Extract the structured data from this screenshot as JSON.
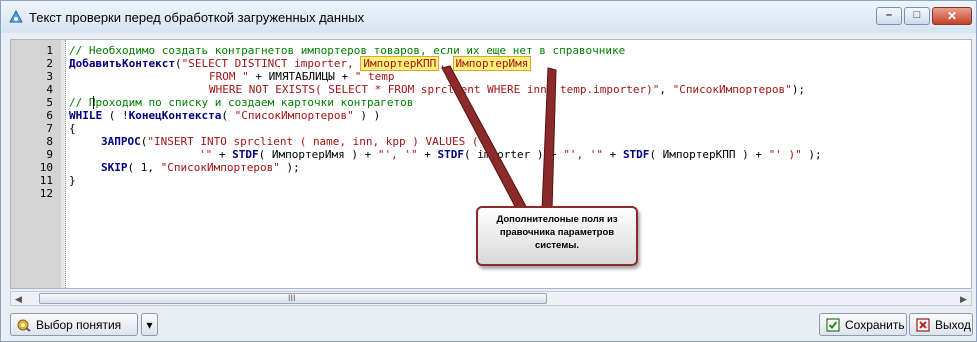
{
  "window": {
    "title": "Текст проверки перед обработкой загруженных данных",
    "controls": {
      "minimize": "–",
      "maximize": "□",
      "close": "✕"
    }
  },
  "editor": {
    "line_numbers": [
      "1",
      "2",
      "3",
      "4",
      "5",
      "6",
      "7",
      "8",
      "9",
      "10",
      "11",
      "12"
    ],
    "lines": {
      "l1": "// Необходимо создать контрагнетов импортеров товаров, если их еще нет в справочнике",
      "l2_fn": "ДобавитьКонтекст",
      "l2_open": "(",
      "l2_str": "\"SELECT DISTINCT importer, ",
      "l2_hl1": "ИмпортерКПП",
      "l2_sep": ", ",
      "l2_hl2": "ИмпортерИмя",
      "l3_str1": "FROM \" ",
      "l3_op": "+ ИМЯТАБЛИЦЫ + ",
      "l3_str2": "\" temp",
      "l4_str": "WHERE NOT EXISTS( SELECT * FROM sprclient WHERE inn= temp.importer)\"",
      "l4_rest": ", ",
      "l4_str2": "\"СписокИмпортеров\"",
      "l4_end": ");",
      "l5": "// Проходим по списку и создаем карточки контрагетов",
      "l6_kw": "WHILE",
      "l6_a": " ( !",
      "l6_fn": "КонецКонтекста",
      "l6_b": "( ",
      "l6_str": "\"СписокИмпортеров\"",
      "l6_c": " ) )",
      "l7": "{",
      "l8_fn": "ЗАПРОС",
      "l8_a": "(",
      "l8_str": "\"INSERT INTO sprclient ( name, inn, kpp ) VALUES (",
      "l9_str1": "'\" ",
      "l9_a": "+ ",
      "l9_fn1": "STDF",
      "l9_b": "( ИмпортерИмя ) + ",
      "l9_str2": "\"', '\"",
      "l9_c": " + ",
      "l9_fn2": "STDF",
      "l9_d": "( importer ) + ",
      "l9_str3": "\"', '\"",
      "l9_e": " + ",
      "l9_fn3": "STDF",
      "l9_f": "( ИмпортерКПП ) + ",
      "l9_str4": "\"' )\"",
      "l9_g": " );",
      "l10_fn": "SKIP",
      "l10_a": "( 1, ",
      "l10_str": "\"СписокИмпортеров\"",
      "l10_b": " );",
      "l11": "}"
    }
  },
  "scrollbar": {
    "left_arrow": "◀",
    "right_arrow": "▶",
    "grip": "III"
  },
  "callout": {
    "text": "Дополнителоные поля из правочника параметров системы."
  },
  "buttons": {
    "choose_concept": "Выбор понятия",
    "dropdown": "▾",
    "save": "Сохранить",
    "exit": "Выход"
  }
}
